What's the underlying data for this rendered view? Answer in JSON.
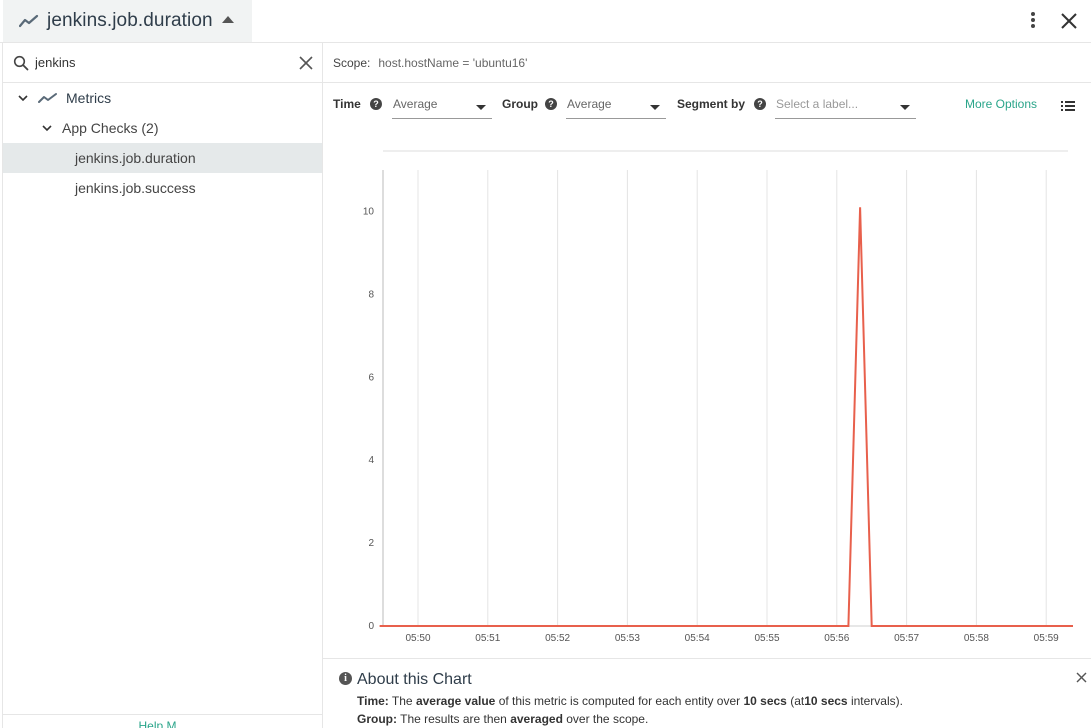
{
  "header": {
    "title": "jenkins.job.duration"
  },
  "sidebar": {
    "search": {
      "value": "jenkins",
      "placeholder": ""
    },
    "tree": {
      "root_label": "Metrics",
      "group_label": "App Checks (2)",
      "items": [
        {
          "label": "jenkins.job.duration",
          "selected": true
        },
        {
          "label": "jenkins.job.success",
          "selected": false
        }
      ]
    },
    "footer_label": "Help M..."
  },
  "scope": {
    "label": "Scope:",
    "value": "host.hostName = 'ubuntu16'"
  },
  "controls": {
    "time": {
      "label": "Time",
      "value": "Average"
    },
    "group": {
      "label": "Group",
      "value": "Average"
    },
    "segment": {
      "label": "Segment by",
      "placeholder": "Select a label..."
    },
    "more_options": "More Options"
  },
  "colors": {
    "accent": "#2aa58a",
    "series": "#e8604c",
    "selected_row": "#e5e9ea"
  },
  "chart_data": {
    "type": "line",
    "x": [
      "05:50",
      "05:51",
      "05:52",
      "05:53",
      "05:54",
      "05:55",
      "05:56",
      "05:57",
      "05:58",
      "05:59"
    ],
    "ylim": [
      0,
      11
    ],
    "yticks": [
      0,
      2,
      4,
      6,
      8,
      10
    ],
    "grid": "vertical",
    "series": [
      {
        "color": "#e8604c",
        "points": [
          {
            "x": "05:49:27",
            "y": 0
          },
          {
            "x": "05:56:10",
            "y": 0
          },
          {
            "x": "05:56:20",
            "y": 10.1
          },
          {
            "x": "05:56:30",
            "y": 0
          },
          {
            "x": "05:59:23",
            "y": 0
          }
        ]
      }
    ]
  },
  "about": {
    "heading": "About this Chart",
    "time_label": "Time:",
    "time_text_1": "The",
    "time_bold_1": "average value",
    "time_text_2": "of this metric is computed for each entity over",
    "time_bold_2": "10 secs",
    "time_text_3": "(at",
    "time_bold_3": "10 secs",
    "time_text_4": "intervals).",
    "group_label": "Group:",
    "group_text_1": "The results are then",
    "group_bold_1": "averaged",
    "group_text_2": "over the scope."
  }
}
